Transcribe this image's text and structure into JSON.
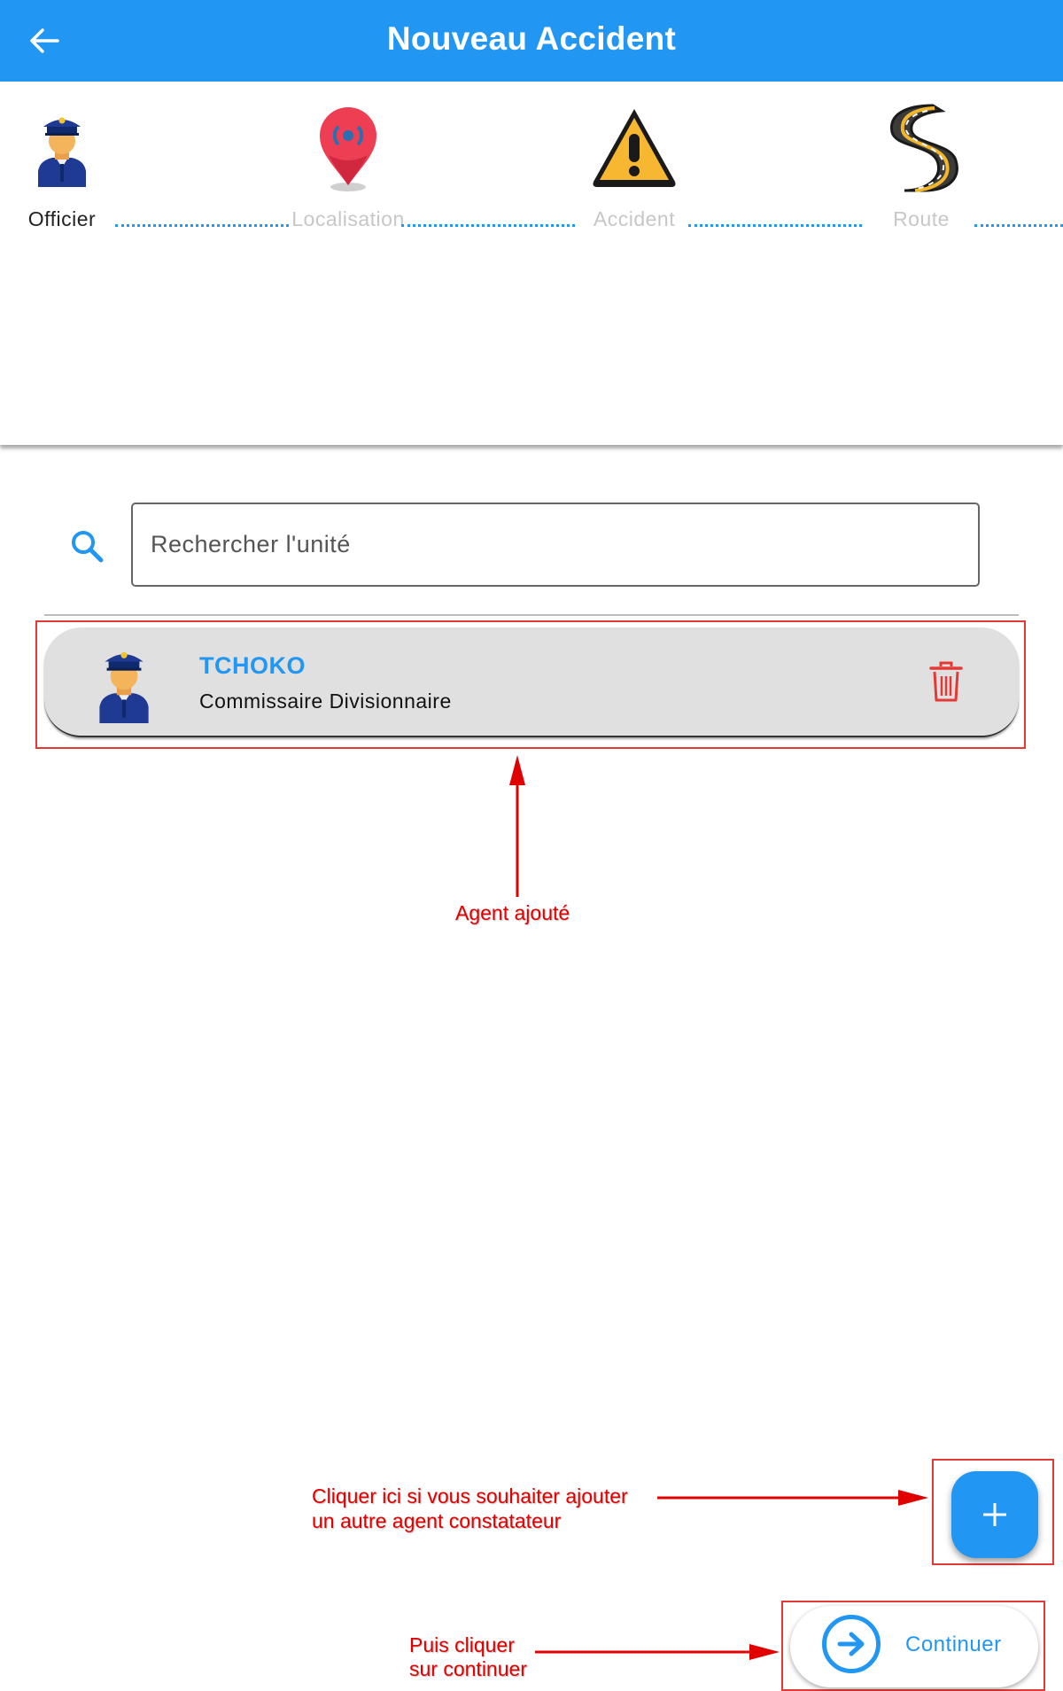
{
  "appbar": {
    "title": "Nouveau Accident",
    "back_icon": "arrow-left-icon"
  },
  "stepper": {
    "steps": [
      {
        "label": "Officier",
        "icon": "police-officer-icon",
        "active": true
      },
      {
        "label": "Localisation",
        "icon": "location-pin-icon",
        "active": false
      },
      {
        "label": "Accident",
        "icon": "warning-triangle-icon",
        "active": false
      },
      {
        "label": "Route",
        "icon": "road-icon",
        "active": false
      }
    ]
  },
  "search": {
    "placeholder": "Rechercher l'unité",
    "icon": "search-icon"
  },
  "agents": [
    {
      "name": "TCHOKO",
      "rank": "Commissaire Divisionnaire",
      "avatar": "police-officer-icon",
      "delete_icon": "trash-icon"
    }
  ],
  "fab": {
    "icon": "plus-icon"
  },
  "continue_button": {
    "label": "Continuer",
    "icon": "arrow-right-circle-icon"
  },
  "annotations": {
    "agent_added": "Agent ajouté",
    "add_hint_line1": "Cliquer ici si vous souhaiter ajouter",
    "add_hint_line2": "un autre agent constatateur",
    "continue_hint_line1": "Puis cliquer",
    "continue_hint_line2": "sur continuer"
  },
  "colors": {
    "primary": "#2196f3",
    "annotation": "#e00000",
    "card": "#e0e0e0",
    "danger": "#e53935"
  }
}
